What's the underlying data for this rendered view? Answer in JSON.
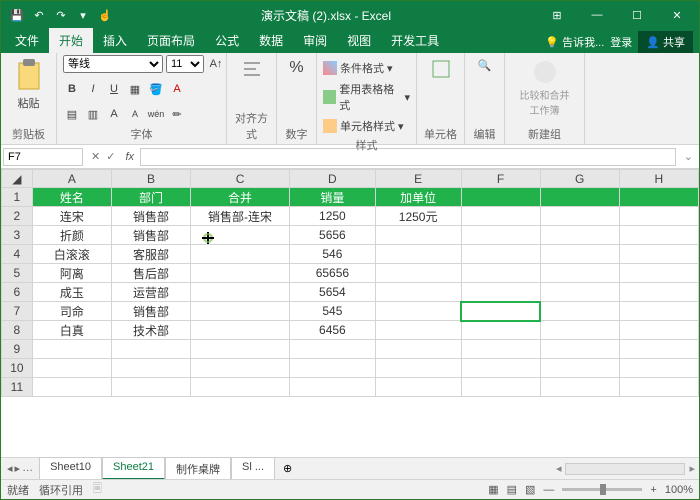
{
  "title": "演示文稿 (2).xlsx - Excel",
  "qat": {
    "save": "💾",
    "undo": "↶",
    "redo": "↷",
    "repeat": "⟳"
  },
  "tabs": [
    "文件",
    "开始",
    "插入",
    "页面布局",
    "公式",
    "数据",
    "审阅",
    "视图",
    "开发工具"
  ],
  "activeTab": 1,
  "tell_me": "告诉我...",
  "login": "登录",
  "share": "共享",
  "ribbon": {
    "clipboard": {
      "label": "剪贴板",
      "paste": "粘贴"
    },
    "font": {
      "label": "字体",
      "name": "等线",
      "size": "11",
      "bold": "B",
      "italic": "I",
      "underline": "U"
    },
    "align": {
      "label": "对齐方式"
    },
    "number": {
      "label": "数字",
      "pct": "%"
    },
    "styles": {
      "label": "样式",
      "cond": "条件格式",
      "table": "套用表格格式",
      "cell": "单元格样式"
    },
    "cells": {
      "label": "单元格"
    },
    "edit": {
      "label": "编辑"
    },
    "newgroup": {
      "label": "新建组",
      "compare": "比较和合并工作簿"
    }
  },
  "namebox": "F7",
  "formula": "",
  "cols": [
    "A",
    "B",
    "C",
    "D",
    "E",
    "F",
    "G",
    "H"
  ],
  "rows": [
    1,
    2,
    3,
    4,
    5,
    6,
    7,
    8,
    9,
    10,
    11
  ],
  "chart_data": {
    "type": "table",
    "headers": [
      "姓名",
      "部门",
      "合并",
      "销量",
      "加单位"
    ],
    "data": [
      [
        "连宋",
        "销售部",
        "销售部-连宋",
        1250,
        "1250元"
      ],
      [
        "折颜",
        "销售部",
        "",
        5656,
        ""
      ],
      [
        "白滚滚",
        "客服部",
        "",
        546,
        ""
      ],
      [
        "阿离",
        "售后部",
        "",
        65656,
        ""
      ],
      [
        "成玉",
        "运营部",
        "",
        5654,
        ""
      ],
      [
        "司命",
        "销售部",
        "",
        545,
        ""
      ],
      [
        "白真",
        "技术部",
        "",
        6456,
        ""
      ]
    ]
  },
  "sheetTabs": [
    "Sheet10",
    "Sheet21",
    "制作桌牌",
    "Sl ..."
  ],
  "activeSheet": 1,
  "status": {
    "ready": "就绪",
    "circ": "循环引用",
    "zoom": "100%"
  },
  "selectedCell": "F7"
}
